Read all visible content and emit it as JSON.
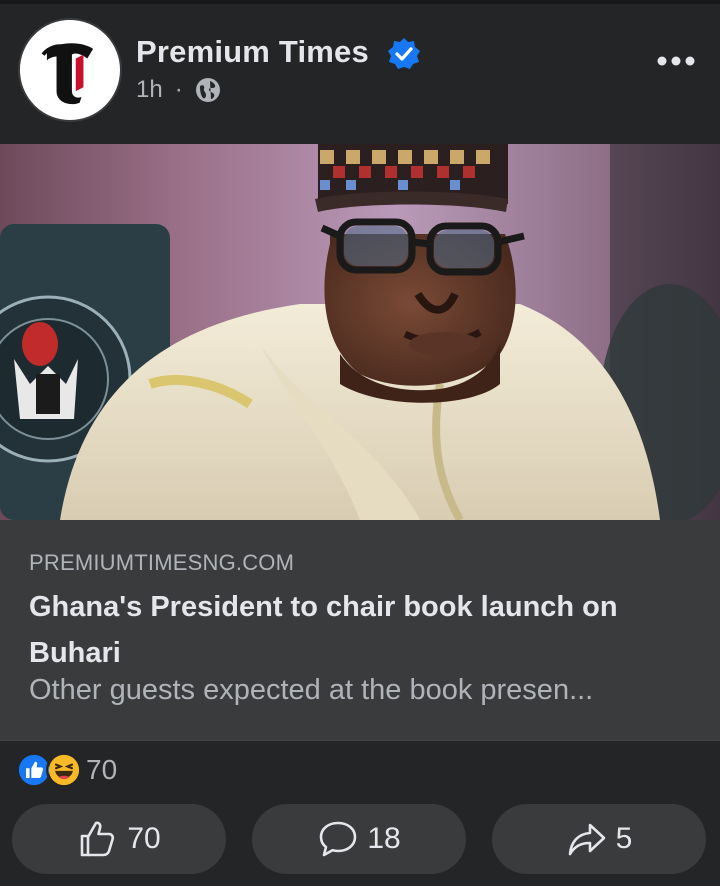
{
  "post": {
    "page_name": "Premium Times",
    "time": "1h",
    "separator": "·",
    "verified_icon": "verified-badge-icon",
    "audience_icon": "globe-icon",
    "more_icon": "more-options-icon",
    "logo_text": "T"
  },
  "link_preview": {
    "domain": "PREMIUMTIMESNG.COM",
    "headline": "Ghana's President to chair book launch on Buhari",
    "description": "Other guests expected at the book presen..."
  },
  "reactions": {
    "icons": [
      "like-reaction-icon",
      "haha-reaction-icon"
    ],
    "count": "70"
  },
  "actions": {
    "like": {
      "label": "70",
      "icon": "thumbs-up-icon"
    },
    "comment": {
      "label": "18",
      "icon": "comment-bubble-icon"
    },
    "share": {
      "label": "5",
      "icon": "share-arrow-icon"
    }
  },
  "colors": {
    "background": "#242526",
    "link_box": "#3a3b3c",
    "verified": "#1877f2",
    "text_primary": "#e4e6eb",
    "text_secondary": "#b0b3b8"
  }
}
